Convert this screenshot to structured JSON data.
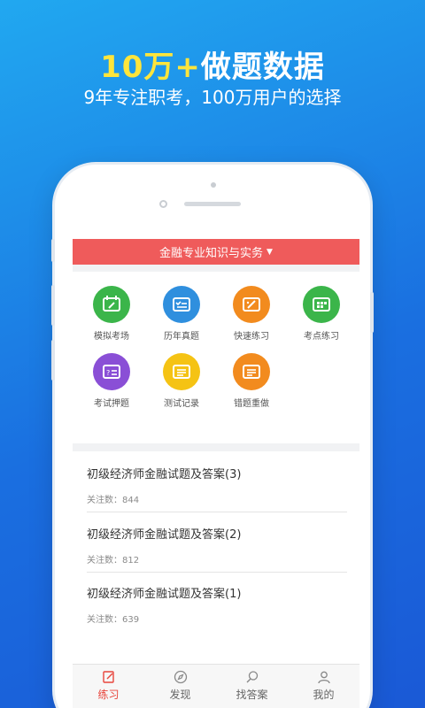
{
  "promo": {
    "headline_accent": "10万+",
    "headline_rest": "做题数据",
    "subline": "9年专注职考，100万用户的选择"
  },
  "app": {
    "subject": "金融专业知识与实务",
    "modules": [
      {
        "label": "模拟考场",
        "icon": "pencil-board-icon",
        "color": "#3bb54a"
      },
      {
        "label": "历年真题",
        "icon": "checklist-icon",
        "color": "#2f8fde"
      },
      {
        "label": "快速练习",
        "icon": "quick-edit-icon",
        "color": "#f28b1e"
      },
      {
        "label": "考点练习",
        "icon": "calendar-grid-icon",
        "color": "#3bb54a"
      },
      {
        "label": "考试押题",
        "icon": "question-list-icon",
        "color": "#8a4fd6"
      },
      {
        "label": "测试记录",
        "icon": "record-list-icon",
        "color": "#f5c314"
      },
      {
        "label": "错题重做",
        "icon": "redo-list-icon",
        "color": "#f28b1e"
      }
    ],
    "articles": [
      {
        "title": "初级经济师金融试题及答案(3)",
        "meta": "关注数：844"
      },
      {
        "title": "初级经济师金融试题及答案(2)",
        "meta": "关注数：812"
      },
      {
        "title": "初级经济师金融试题及答案(1)",
        "meta": "关注数：639"
      }
    ],
    "tabs": [
      {
        "label": "练习",
        "icon": "edit-icon",
        "active": true
      },
      {
        "label": "发现",
        "icon": "compass-icon",
        "active": false
      },
      {
        "label": "找答案",
        "icon": "search-icon",
        "active": false
      },
      {
        "label": "我的",
        "icon": "user-icon",
        "active": false
      }
    ],
    "colors": {
      "accent_red": "#ef5b5b",
      "active_tab": "#e8453c",
      "headline_yellow": "#ffe53b"
    }
  }
}
